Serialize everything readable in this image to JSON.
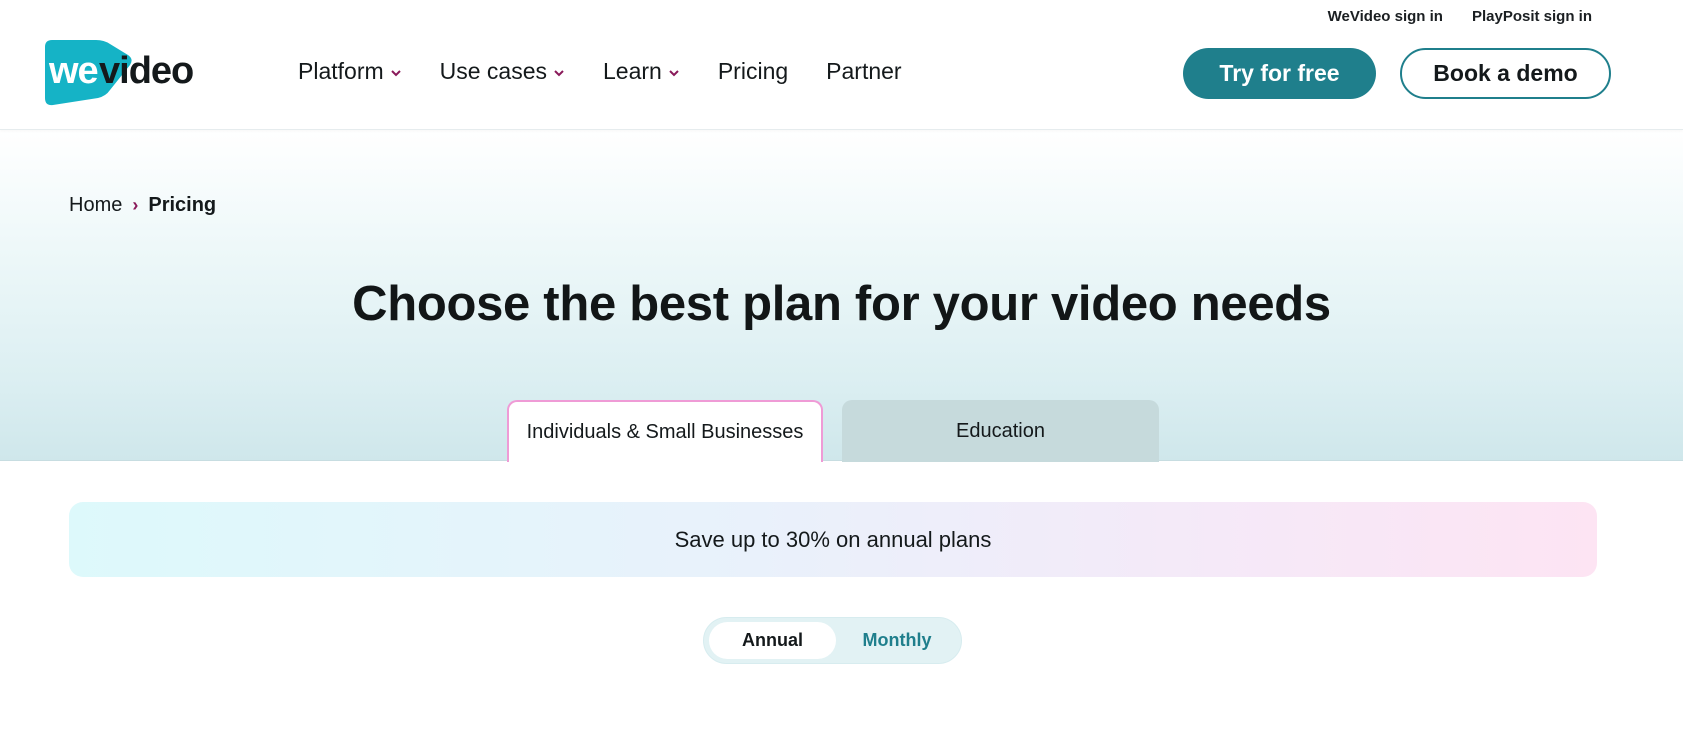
{
  "header": {
    "top_links": {
      "wevideo_sign_in": "WeVideo sign in",
      "playposit_sign_in": "PlayPosit sign in"
    },
    "logo": {
      "part1": "we",
      "part2": "video",
      "accent_color": "#15b3c6"
    },
    "nav": {
      "platform": "Platform",
      "use_cases": "Use cases",
      "learn": "Learn",
      "pricing": "Pricing",
      "partner": "Partner"
    },
    "try_button": "Try for free",
    "demo_button": "Book a demo"
  },
  "breadcrumb": {
    "home": "Home",
    "separator": "›",
    "current": "Pricing"
  },
  "hero": {
    "title": "Choose the best plan for your video needs"
  },
  "tabs": {
    "individuals": "Individuals & Small Businesses",
    "education": "Education",
    "active": "individuals"
  },
  "promo": {
    "text": "Save up to 30% on annual plans"
  },
  "billing": {
    "annual": "Annual",
    "monthly": "Monthly",
    "selected": "annual"
  },
  "colors": {
    "brand_teal": "#1f7f8c",
    "accent_magenta": "#8a1a5a",
    "tab_active_border": "#ef9bd6"
  }
}
